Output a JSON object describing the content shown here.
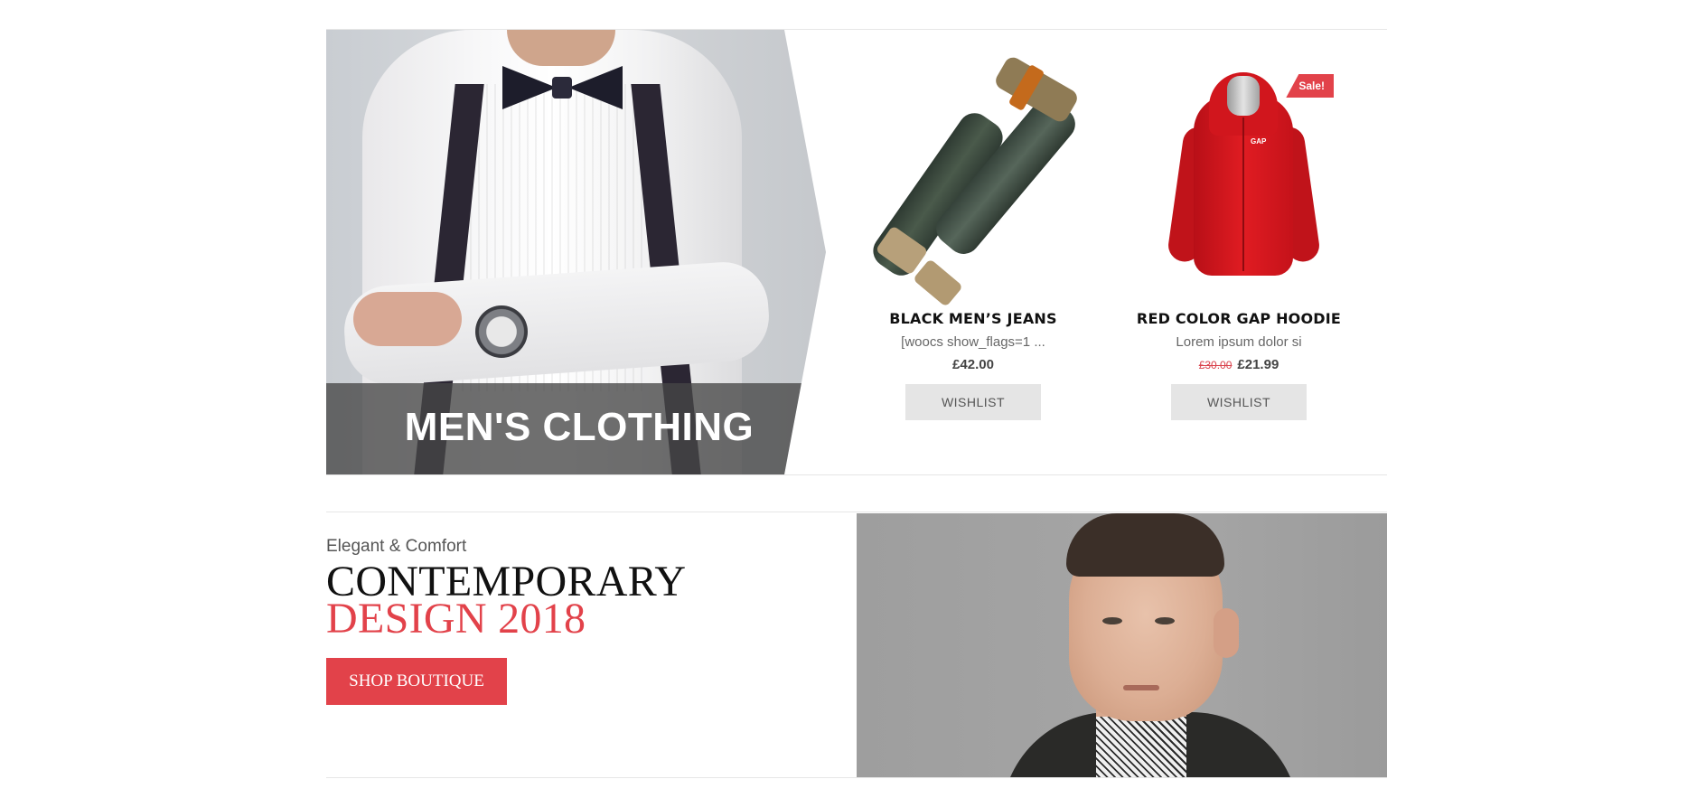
{
  "banner": {
    "title": "MEN'S CLOTHING"
  },
  "products": [
    {
      "name": "BLACK MEN’S JEANS",
      "description": "[woocs show_flags=1 ...",
      "price": "£42.00",
      "wishlist_label": "WISHLIST"
    },
    {
      "name": "RED COLOR GAP HOODIE",
      "description": "Lorem ipsum dolor si",
      "old_price": "£30.00",
      "price": "£21.99",
      "badge": "Sale!",
      "logo_text": "GAP",
      "wishlist_label": "WISHLIST"
    }
  ],
  "promo": {
    "subtitle": "Elegant & Comfort",
    "headline_line1": "CONTEMPORARY",
    "headline_line2": "DESIGN 2018",
    "button_label": "SHOP BOUTIQUE"
  },
  "colors": {
    "accent": "#e2424a",
    "wishlist_bg": "#e5e5e5",
    "divider": "#e6e6e6"
  }
}
